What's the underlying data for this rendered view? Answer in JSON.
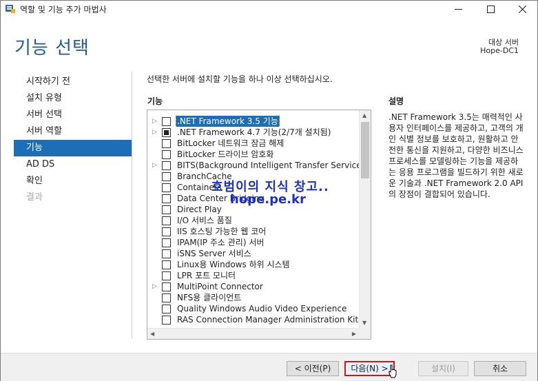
{
  "window": {
    "title": "역할 및 기능 추가 마법사"
  },
  "header": {
    "title": "기능 선택",
    "target_label": "대상 서버",
    "target_name": "Hope-DC1"
  },
  "nav": {
    "items": [
      {
        "label": "시작하기 전",
        "state": "normal"
      },
      {
        "label": "설치 유형",
        "state": "normal"
      },
      {
        "label": "서버 선택",
        "state": "normal"
      },
      {
        "label": "서버 역할",
        "state": "normal"
      },
      {
        "label": "기능",
        "state": "active"
      },
      {
        "label": "AD DS",
        "state": "normal"
      },
      {
        "label": "확인",
        "state": "normal"
      },
      {
        "label": "결과",
        "state": "disabled"
      }
    ]
  },
  "content": {
    "instruction": "선택한 서버에 설치할 기능을 하나 이상 선택하십시오.",
    "features_label": "기능",
    "description_label": "설명",
    "description_text": ".NET Framework 3.5는 매력적인 사용자 인터페이스를 제공하고, 고객의 개인 식별 정보를 보호하고, 원활하고 안전한 통신을 지원하고, 다양한 비즈니스 프로세스를 모델링하는 기능을 제공하는 응용 프로그램을 빌드하기 위한 새로운 기술과 .NET Framework 2.0 API의 장점이 결합되어 있습니다."
  },
  "features": [
    {
      "label": ".NET Framework 3.5 기능",
      "expandable": true,
      "check": "none",
      "selected": true
    },
    {
      "label": ".NET Framework 4.7 기능(2/7개 설치됨)",
      "expandable": true,
      "check": "partial",
      "selected": false
    },
    {
      "label": "BitLocker 네트워크 잠금 해제",
      "expandable": false,
      "check": "none",
      "selected": false
    },
    {
      "label": "BitLocker 드라이브 암호화",
      "expandable": false,
      "check": "none",
      "selected": false
    },
    {
      "label": "BITS(Background Intelligent Transfer Service)",
      "expandable": true,
      "check": "none",
      "selected": false
    },
    {
      "label": "BranchCache",
      "expandable": false,
      "check": "none",
      "selected": false
    },
    {
      "label": "Containers",
      "expandable": false,
      "check": "none",
      "selected": false
    },
    {
      "label": "Data Center Bridging",
      "expandable": false,
      "check": "none",
      "selected": false
    },
    {
      "label": "Direct Play",
      "expandable": false,
      "check": "none",
      "selected": false
    },
    {
      "label": "I/O 서비스 품질",
      "expandable": false,
      "check": "none",
      "selected": false
    },
    {
      "label": "IIS 호스팅 가능한 웹 코어",
      "expandable": false,
      "check": "none",
      "selected": false
    },
    {
      "label": "IPAM(IP 주소 관리) 서버",
      "expandable": false,
      "check": "none",
      "selected": false
    },
    {
      "label": "iSNS Server 서비스",
      "expandable": false,
      "check": "none",
      "selected": false
    },
    {
      "label": "Linux용 Windows 하위 시스템",
      "expandable": false,
      "check": "none",
      "selected": false
    },
    {
      "label": "LPR 포트 모니터",
      "expandable": false,
      "check": "none",
      "selected": false
    },
    {
      "label": "MultiPoint Connector",
      "expandable": true,
      "check": "none",
      "selected": false
    },
    {
      "label": "NFS용 클라이언트",
      "expandable": false,
      "check": "none",
      "selected": false
    },
    {
      "label": "Quality Windows Audio Video Experience",
      "expandable": false,
      "check": "none",
      "selected": false
    },
    {
      "label": "RAS Connection Manager Administration Kit (CM",
      "expandable": false,
      "check": "none",
      "selected": false
    }
  ],
  "watermark": {
    "line1": "호범이의 지식 창고..",
    "line2": "hope.pe.kr"
  },
  "footer": {
    "prev_label": "< 이전(P)",
    "next_label": "다음(N) >",
    "install_label": "설치(I)",
    "cancel_label": "취소"
  },
  "colors": {
    "accent": "#1c6fb7",
    "title_blue": "#1e5a9a",
    "highlight_border": "#d31219",
    "watermark": "#1a2fcf"
  }
}
